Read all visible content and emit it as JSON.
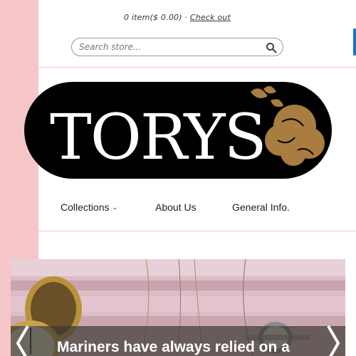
{
  "cart": {
    "summary": "0 item($ 0.00)",
    "separator": "·",
    "checkout_label": "Check out"
  },
  "search": {
    "placeholder": "Search store...",
    "icon": "search-icon"
  },
  "logo": {
    "brand_text": "TORYS",
    "colors": {
      "background": "#000000",
      "text": "#ffffff",
      "flower": "#a87d3f"
    }
  },
  "nav": {
    "items": [
      {
        "label": "Collections",
        "has_dropdown": true
      },
      {
        "label": "About Us",
        "has_dropdown": false
      },
      {
        "label": "General Info.",
        "has_dropdown": false
      }
    ],
    "dropdown_icon": "chevron-down-icon"
  },
  "hero": {
    "caption": "Mariners have always relied on a",
    "prev_icon": "chevron-left-icon",
    "next_icon": "chevron-right-icon"
  },
  "colors": {
    "side_strip": "#f6c6c9",
    "divider": "#f2c4c7",
    "side_tab": "#1a73c7"
  }
}
